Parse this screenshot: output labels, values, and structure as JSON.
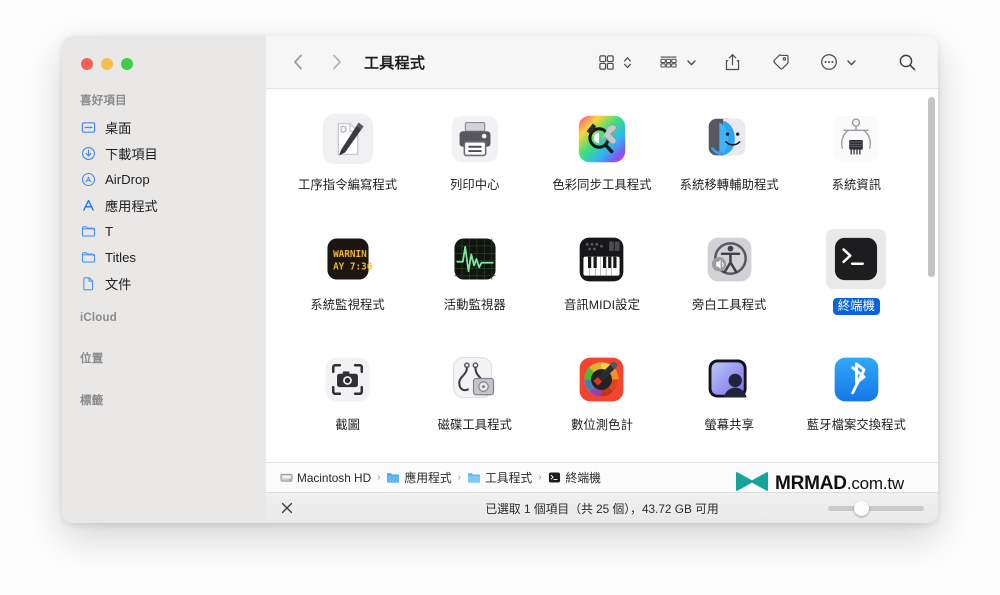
{
  "window": {
    "title": "工具程式",
    "traffic_lights": [
      {
        "name": "close",
        "color": "#f2605a"
      },
      {
        "name": "minimize",
        "color": "#f6be4f"
      },
      {
        "name": "zoom",
        "color": "#3ecc49"
      }
    ]
  },
  "sidebar": {
    "sections": [
      {
        "label": "喜好項目",
        "items": [
          {
            "label": "桌面",
            "icon": "desktop-icon"
          },
          {
            "label": "下載項目",
            "icon": "downloads-icon"
          },
          {
            "label": "AirDrop",
            "icon": "airdrop-icon"
          },
          {
            "label": "應用程式",
            "icon": "applications-icon"
          },
          {
            "label": "T",
            "icon": "folder-icon"
          },
          {
            "label": "Titles",
            "icon": "folder-icon"
          },
          {
            "label": "文件",
            "icon": "document-icon"
          }
        ]
      },
      {
        "label": "iCloud",
        "items": []
      },
      {
        "label": "位置",
        "items": []
      },
      {
        "label": "標籤",
        "items": []
      }
    ]
  },
  "toolbar": {
    "back_icon": "chevron-left-icon",
    "forward_icon": "chevron-right-icon",
    "view_icon": "icon-view-icon",
    "view_chevron": "chevron-updown-icon",
    "group_icon": "group-by-icon",
    "group_chevron": "chevron-down-icon",
    "share_icon": "share-icon",
    "tag_icon": "tag-icon",
    "more_icon": "more-options-icon",
    "more_chevron": "chevron-down-icon",
    "search_icon": "search-icon"
  },
  "main": {
    "apps": [
      {
        "label": "工序指令編寫程式",
        "icon": "script-editor-icon",
        "selected": false
      },
      {
        "label": "列印中心",
        "icon": "print-center-icon",
        "selected": false
      },
      {
        "label": "色彩同步工具程式",
        "icon": "colorsync-utility-icon",
        "selected": false
      },
      {
        "label": "系統移轉輔助程式",
        "icon": "migration-assistant-icon",
        "selected": false
      },
      {
        "label": "系統資訊",
        "icon": "system-information-icon",
        "selected": false
      },
      {
        "label": "系統監視程式",
        "icon": "console-icon",
        "selected": false
      },
      {
        "label": "活動監視器",
        "icon": "activity-monitor-icon",
        "selected": false
      },
      {
        "label": "音訊MIDI設定",
        "icon": "audio-midi-setup-icon",
        "selected": false
      },
      {
        "label": "旁白工具程式",
        "icon": "voiceover-utility-icon",
        "selected": false
      },
      {
        "label": "終端機",
        "icon": "terminal-icon",
        "selected": true
      },
      {
        "label": "截圖",
        "icon": "screenshot-icon",
        "selected": false
      },
      {
        "label": "磁碟工具程式",
        "icon": "disk-utility-icon",
        "selected": false
      },
      {
        "label": "數位測色計",
        "icon": "digital-color-meter-icon",
        "selected": false
      },
      {
        "label": "螢幕共享",
        "icon": "screen-sharing-icon",
        "selected": false
      },
      {
        "label": "藍牙檔案交換程式",
        "icon": "bluetooth-file-exchange-icon",
        "selected": false
      }
    ]
  },
  "path_bar": {
    "crumbs": [
      {
        "label": "Macintosh HD",
        "icon": "harddisk-icon"
      },
      {
        "label": "應用程式",
        "icon": "folder-blue-icon"
      },
      {
        "label": "工具程式",
        "icon": "folder-blue-icon"
      },
      {
        "label": "終端機",
        "icon": "terminal-small-icon"
      }
    ],
    "separator": "›"
  },
  "status_bar": {
    "close_icon": "close-x-icon",
    "status_text": "已選取 1 個項目（共 25 個），43.72 GB 可用",
    "zoom_slider_name": "icon-size-slider"
  },
  "watermark": {
    "logo_icon": "mrmad-logo-icon",
    "brand": "MRMAD",
    "tld": ".com.tw",
    "logo_color": "#16a39b"
  },
  "colors": {
    "selection_blue": "#0a64e0",
    "annotation_red": "#ff2020",
    "sidebar_bg": "#e9e8e7"
  }
}
